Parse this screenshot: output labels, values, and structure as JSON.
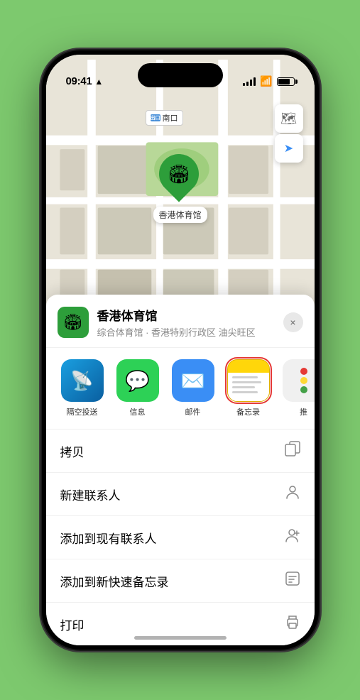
{
  "status_bar": {
    "time": "09:41",
    "location_arrow": "▲"
  },
  "map": {
    "label_text": "南口",
    "controls": {
      "map_type_icon": "🗺",
      "location_icon": "➤"
    },
    "pin": {
      "label": "香港体育馆",
      "emoji": "🏟"
    }
  },
  "venue": {
    "name": "香港体育馆",
    "description": "综合体育馆 · 香港特别行政区 油尖旺区",
    "emoji": "🏟",
    "close_label": "×"
  },
  "share_items": [
    {
      "id": "airdrop",
      "label": "隔空投送",
      "type": "airdrop"
    },
    {
      "id": "messages",
      "label": "信息",
      "type": "messages"
    },
    {
      "id": "mail",
      "label": "邮件",
      "type": "mail"
    },
    {
      "id": "notes",
      "label": "备忘录",
      "type": "notes"
    },
    {
      "id": "more",
      "label": "推",
      "type": "more"
    }
  ],
  "actions": [
    {
      "id": "copy",
      "label": "拷贝",
      "icon": "copy"
    },
    {
      "id": "new-contact",
      "label": "新建联系人",
      "icon": "person"
    },
    {
      "id": "add-existing",
      "label": "添加到现有联系人",
      "icon": "person-add"
    },
    {
      "id": "add-notes",
      "label": "添加到新快速备忘录",
      "icon": "note"
    },
    {
      "id": "print",
      "label": "打印",
      "icon": "print"
    }
  ]
}
